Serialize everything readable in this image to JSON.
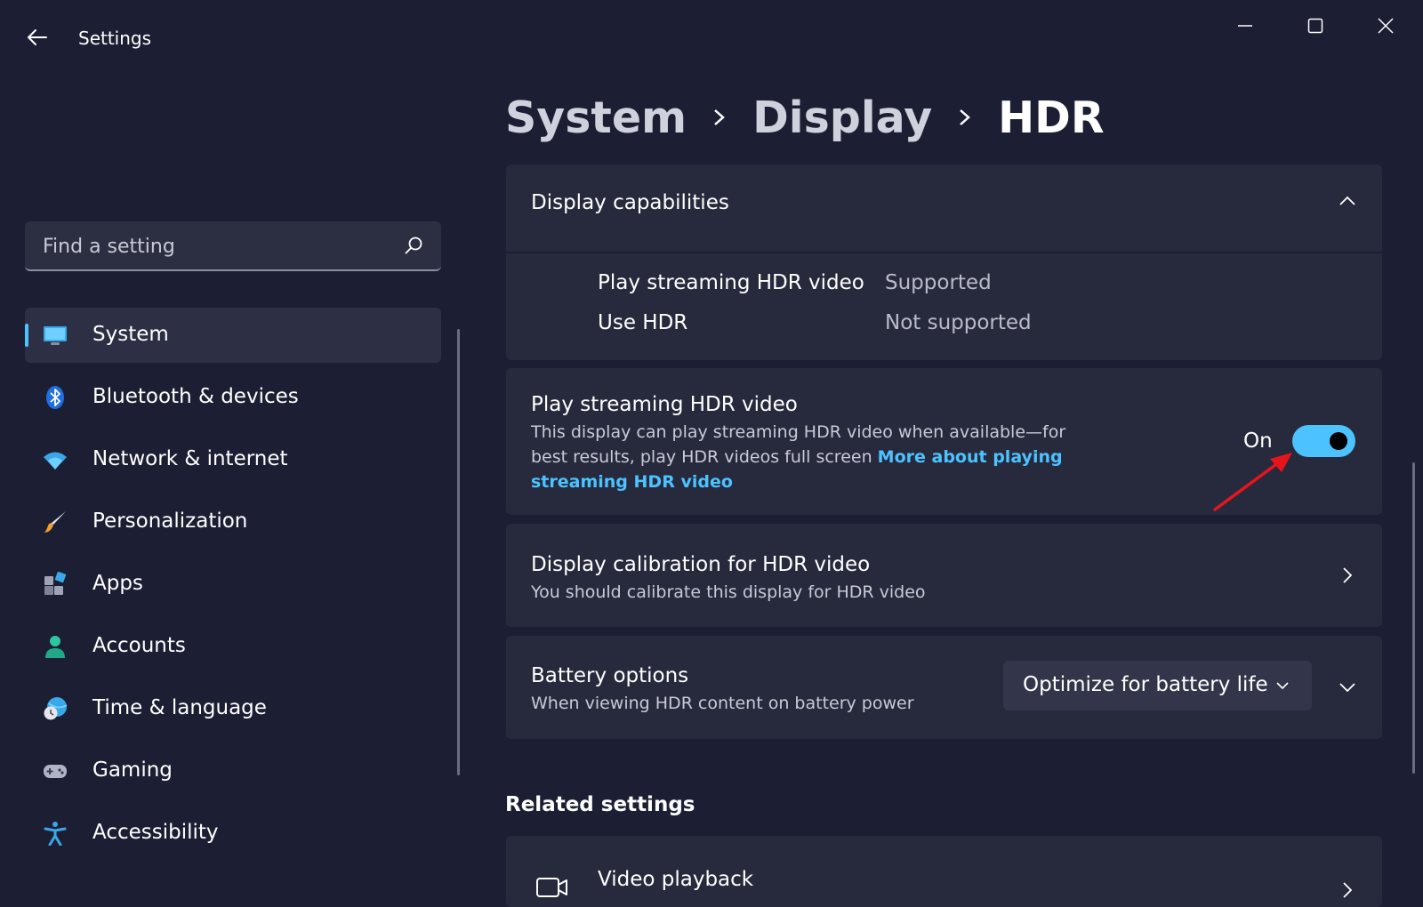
{
  "window": {
    "title": "Settings",
    "back_icon": "arrow-left-icon",
    "controls": [
      "minimize-icon",
      "maximize-icon",
      "close-icon"
    ]
  },
  "sidebar": {
    "search": {
      "placeholder": "Find a setting",
      "value": "",
      "icon": "search-icon"
    },
    "items": [
      {
        "label": "System",
        "icon": "monitor-icon",
        "active": true
      },
      {
        "label": "Bluetooth & devices",
        "icon": "bluetooth-icon"
      },
      {
        "label": "Network & internet",
        "icon": "wifi-icon"
      },
      {
        "label": "Personalization",
        "icon": "brush-icon"
      },
      {
        "label": "Apps",
        "icon": "apps-icon"
      },
      {
        "label": "Accounts",
        "icon": "person-icon"
      },
      {
        "label": "Time & language",
        "icon": "globe-clock-icon"
      },
      {
        "label": "Gaming",
        "icon": "gamepad-icon"
      },
      {
        "label": "Accessibility",
        "icon": "accessibility-icon"
      }
    ]
  },
  "breadcrumb": [
    "System",
    "Display",
    "HDR"
  ],
  "capabilities": {
    "title": "Display capabilities",
    "rows": [
      {
        "label": "Play streaming HDR video",
        "value": "Supported"
      },
      {
        "label": "Use HDR",
        "value": "Not supported"
      }
    ]
  },
  "streaming": {
    "title": "Play streaming HDR video",
    "description": "This display can play streaming HDR video when available—for best results, play HDR videos full screen",
    "link": "More about playing streaming HDR video",
    "toggle_label": "On",
    "toggle_on": true
  },
  "calibration": {
    "title": "Display calibration for HDR video",
    "subtitle": "You should calibrate this display for HDR video"
  },
  "battery": {
    "title": "Battery options",
    "subtitle": "When viewing HDR content on battery power",
    "selected": "Optimize for battery life"
  },
  "related": {
    "heading": "Related settings",
    "items": [
      {
        "label": "Video playback",
        "icon": "video-camera-icon"
      }
    ]
  },
  "colors": {
    "accent": "#4cc2ff",
    "background": "#1c1f33",
    "card": "#272a3d",
    "annotation_arrow": "#e8141c"
  }
}
